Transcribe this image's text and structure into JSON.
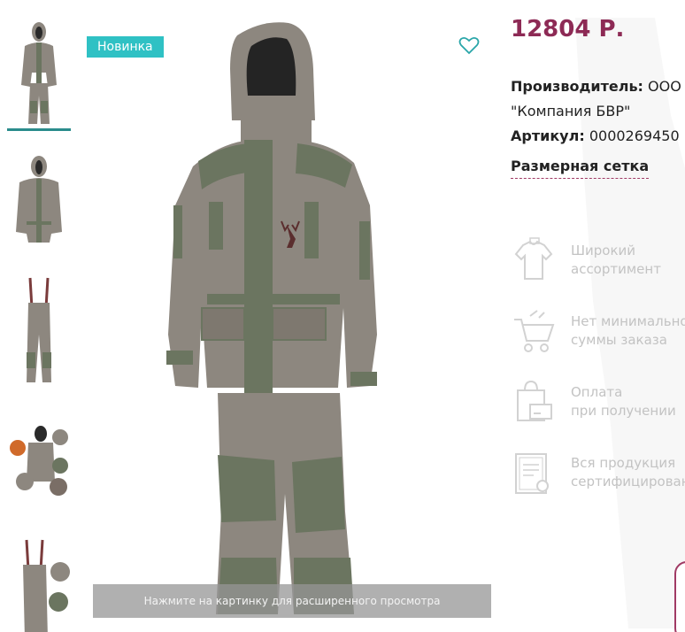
{
  "product": {
    "price": "12804 Р.",
    "badge": "Новинка",
    "manufacturer_label": "Производитель:",
    "manufacturer_value_line1": "ООО",
    "manufacturer_value_line2": "\"Компания БВР\"",
    "article_label": "Артикул:",
    "article_value": "0000269450",
    "size_chart_link": "Размерная сетка",
    "zoom_hint": "Нажмите на картинку для расширенного просмотра"
  },
  "thumbnails": [
    {
      "icon": "suit-front-thumbnail",
      "active": true
    },
    {
      "icon": "jacket-thumbnail",
      "active": false
    },
    {
      "icon": "bib-pants-thumbnail",
      "active": false
    },
    {
      "icon": "suit-details-thumbnail",
      "active": false
    },
    {
      "icon": "bib-pants-detail-thumbnail",
      "active": false
    }
  ],
  "features": [
    {
      "icon": "shirt-icon",
      "line1": "Широкий",
      "line2": "ассортимент"
    },
    {
      "icon": "cart-icon",
      "line1": "Нет минимальной",
      "line2": "суммы заказа"
    },
    {
      "icon": "payment-bag-icon",
      "line1": "Оплата",
      "line2": "при получении"
    },
    {
      "icon": "certificate-icon",
      "line1": "Вся продукция",
      "line2": "сертифицирована"
    }
  ],
  "colors": {
    "price": "#8d2a55",
    "badge": "#2fc1c4",
    "accent_teal": "#2a8c8c",
    "dashed_underline": "#a03a64",
    "feature_text": "#c3c3c3",
    "cloth": "#8d877f",
    "patch": "#6b7560"
  }
}
